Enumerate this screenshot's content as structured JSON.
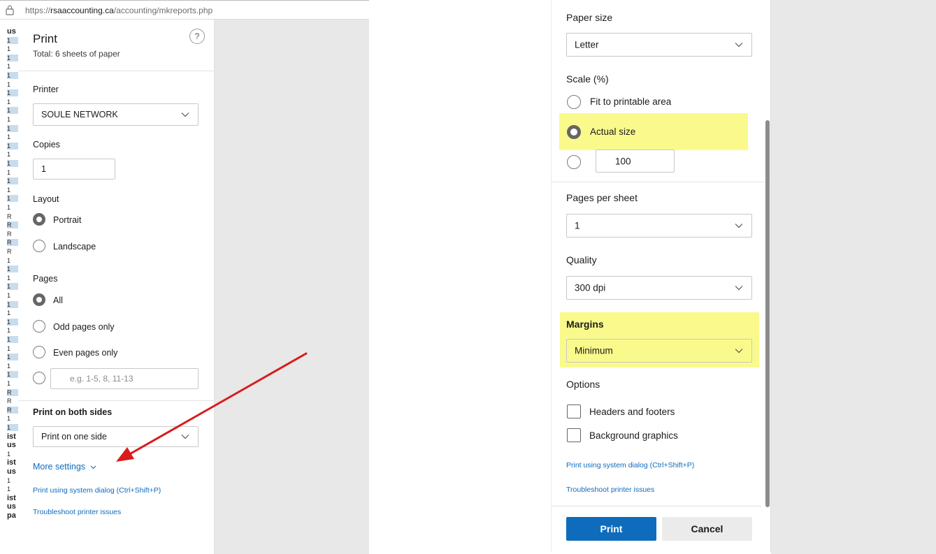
{
  "left": {
    "url": {
      "scheme": "https://",
      "host": "rsaaccounting.ca",
      "path": "/accounting/mkreports.php"
    },
    "header": {
      "title": "Print",
      "subtitle": "Total: 6 sheets of paper",
      "help": "?"
    },
    "printer": {
      "label": "Printer",
      "value": "SOULE NETWORK"
    },
    "copies": {
      "label": "Copies",
      "value": "1"
    },
    "layout": {
      "label": "Layout",
      "options": [
        "Portrait",
        "Landscape"
      ],
      "selected": "Portrait"
    },
    "pages": {
      "label": "Pages",
      "options": [
        "All",
        "Odd pages only",
        "Even pages only"
      ],
      "selected": "All",
      "custom_placeholder": "e.g. 1-5, 8, 11-13"
    },
    "duplex": {
      "label": "Print on both sides",
      "value": "Print on one side"
    },
    "links": {
      "more_settings": "More settings",
      "system_dialog": "Print using system dialog (Ctrl+Shift+P)",
      "troubleshoot": "Troubleshoot printer issues"
    },
    "strip": [
      "us",
      "1",
      "1",
      "1",
      "1",
      "1",
      "1",
      "1",
      "1",
      "1",
      "1",
      "1",
      "1",
      "1",
      "1",
      "1",
      "1",
      "1",
      "1",
      "1",
      "1",
      "R",
      "R",
      "R",
      "R",
      "R",
      "1",
      "1",
      "1",
      "1",
      "1",
      "1",
      "1",
      "1",
      "1",
      "1",
      "1",
      "1",
      "1",
      "1",
      "1",
      "R",
      "R",
      "R",
      "1",
      "1",
      "ist",
      "us",
      "1",
      "ist",
      "us",
      "1",
      "1",
      "ist",
      "us",
      "pa"
    ]
  },
  "right": {
    "paper_size": {
      "label": "Paper size",
      "value": "Letter"
    },
    "scale": {
      "label": "Scale (%)",
      "options": [
        "Fit to printable area",
        "Actual size"
      ],
      "selected": "Actual size",
      "custom_value": "100"
    },
    "pages_per_sheet": {
      "label": "Pages per sheet",
      "value": "1"
    },
    "quality": {
      "label": "Quality",
      "value": "300 dpi"
    },
    "margins": {
      "label": "Margins",
      "value": "Minimum"
    },
    "options": {
      "label": "Options",
      "items": [
        "Headers and footers",
        "Background graphics"
      ]
    },
    "links": {
      "system_dialog": "Print using system dialog (Ctrl+Shift+P)",
      "troubleshoot": "Troubleshoot printer issues"
    },
    "buttons": {
      "print": "Print",
      "cancel": "Cancel"
    },
    "highlight_color": "#fafa8c"
  },
  "colors": {
    "accent": "#0f6cbd",
    "arrow": "#d91c1c",
    "preview_bg": "#e8e8e8"
  }
}
